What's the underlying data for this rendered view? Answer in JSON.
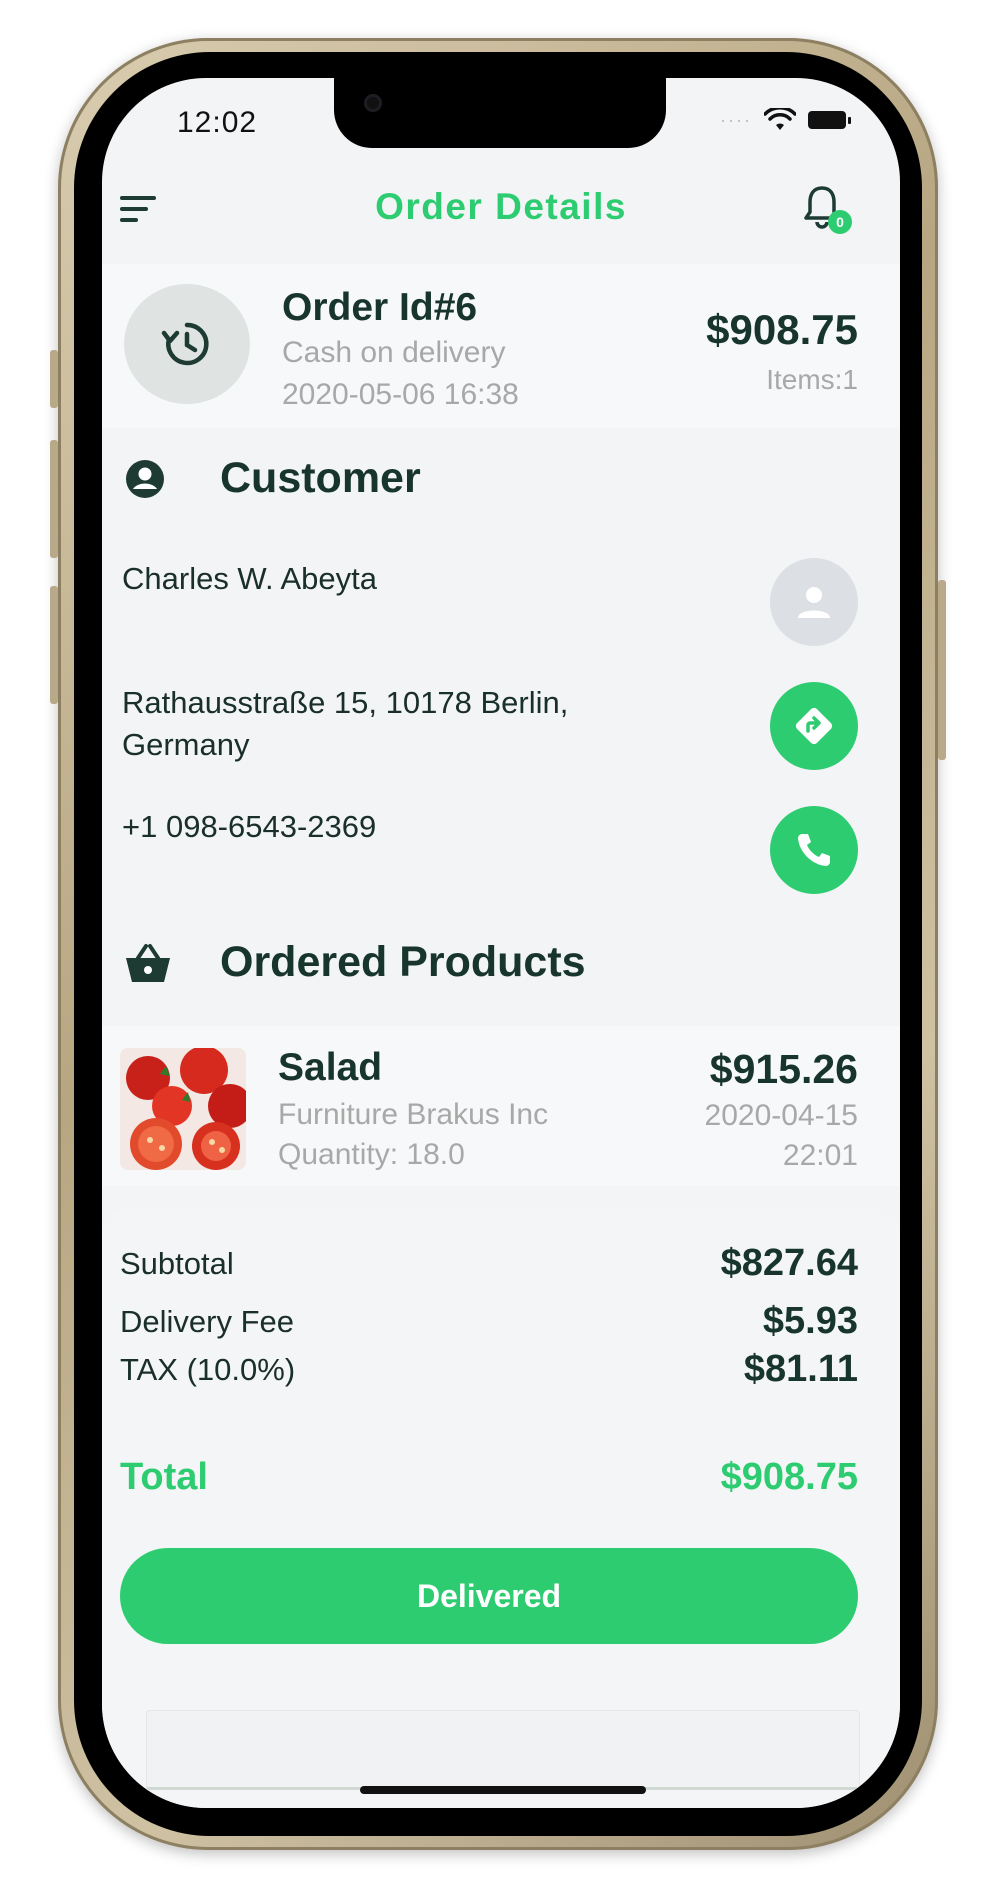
{
  "status_bar": {
    "time": "12:02"
  },
  "header": {
    "title": "Order Details",
    "notification_count": "0"
  },
  "order": {
    "id": "Order Id#6",
    "payment": "Cash on delivery",
    "date": "2020-05-06 16:38",
    "total": "$908.75",
    "items": "Items:1"
  },
  "customer": {
    "section_title": "Customer",
    "name": "Charles W. Abeyta",
    "address_line1": "Rathausstraße 15, 10178 Berlin,",
    "address_line2": "Germany",
    "phone": "+1 098-6543-2369"
  },
  "products": {
    "section_title": "Ordered Products",
    "items": [
      {
        "name": "Salad",
        "vendor": "Furniture Brakus Inc",
        "quantity": "Quantity: 18.0",
        "price": "$915.26",
        "date": "2020-04-15",
        "time": "22:01"
      }
    ]
  },
  "summary": {
    "subtotal_label": "Subtotal",
    "subtotal_value": "$827.64",
    "delivery_label": "Delivery Fee",
    "delivery_value": "$5.93",
    "tax_label": "TAX (10.0%)",
    "tax_value": "$81.11",
    "total_label": "Total",
    "total_value": "$908.75"
  },
  "action": {
    "status_button": "Delivered"
  },
  "colors": {
    "accent": "#2ecc71",
    "text_dark": "#18352d",
    "muted": "#a8a8a8"
  }
}
